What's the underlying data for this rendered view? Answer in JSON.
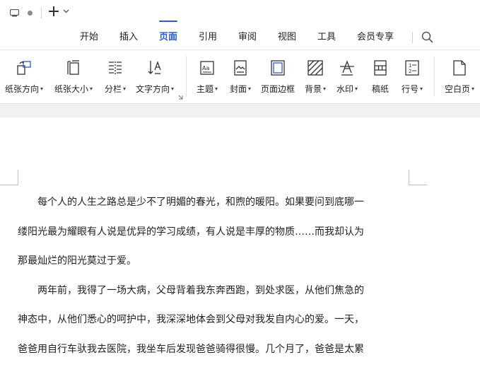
{
  "window": {
    "new_tab_symbol": "+",
    "dropdown_symbol": "⌄"
  },
  "menu": {
    "items": [
      "开始",
      "插入",
      "页面",
      "引用",
      "审阅",
      "视图",
      "工具",
      "会员专享"
    ],
    "active": "页面"
  },
  "ribbon": {
    "tools": [
      {
        "label": "纸张方向",
        "icon": "page-orientation-icon",
        "dropdown": true
      },
      {
        "label": "纸张大小",
        "icon": "page-size-icon",
        "dropdown": true
      },
      {
        "label": "分栏",
        "icon": "columns-icon",
        "dropdown": true
      },
      {
        "label": "文字方向",
        "icon": "text-direction-icon",
        "dropdown": true
      },
      {
        "label": "主题",
        "icon": "theme-icon",
        "dropdown": true
      },
      {
        "label": "封面",
        "icon": "cover-icon",
        "dropdown": true
      },
      {
        "label": "页面边框",
        "icon": "page-border-icon",
        "dropdown": false
      },
      {
        "label": "背景",
        "icon": "background-icon",
        "dropdown": true
      },
      {
        "label": "水印",
        "icon": "watermark-icon",
        "dropdown": true
      },
      {
        "label": "稿纸",
        "icon": "manuscript-paper-icon",
        "dropdown": false
      },
      {
        "label": "行号",
        "icon": "line-numbers-icon",
        "dropdown": true
      },
      {
        "label": "空白页",
        "icon": "blank-page-icon",
        "dropdown": true
      }
    ],
    "accent_color": "#2a5bd7"
  },
  "document": {
    "lines": [
      "　　每个人的人生之路总是少不了明媚的春光，和煦的暖阳。如果要问到底哪一",
      "缕阳光最为耀眼有人说是优异的学习成绩，有人说是丰厚的物质……而我却认为",
      "那最灿烂的阳光莫过于爱。",
      "　　两年前，我得了一场大病，父母背着我东奔西跑，到处求医，从他们焦急的",
      "神态中，从他们悉心的呵护中，我深深地体会到父母对我发自内心的爱。一天，",
      "爸爸用自行车驮我去医院，我坐车后发现爸爸骑得很慢。几个月了，爸爸是太累"
    ]
  }
}
